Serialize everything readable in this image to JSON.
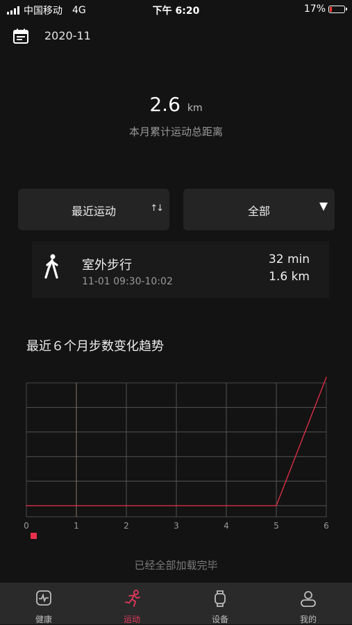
{
  "status_bar": {
    "carrier": "中国移动",
    "network": "4G",
    "time": "下午 6:20",
    "battery": "17%",
    "battery_level": 0.17
  },
  "header": {
    "month": "2020-11",
    "calendar_icon": "calendar-icon"
  },
  "summary": {
    "value": "2.6",
    "unit": "km",
    "label": "本月累计运动总距离"
  },
  "filters": {
    "sort_label": "最近运动",
    "sort_icon": "sort-arrows-icon",
    "type_label": "全部",
    "type_icon": "dropdown-triangle-icon"
  },
  "record": {
    "icon": "walking-icon",
    "title": "室外步行",
    "time": "11-01 09:30-10:02",
    "duration": "32 min",
    "distance": "1.6 km"
  },
  "chart_title": "最近６个月步数变化趋势",
  "chart_data": {
    "type": "line",
    "x": [
      0,
      1,
      2,
      3,
      4,
      5,
      6
    ],
    "series": [
      {
        "values": [
          0,
          0,
          0,
          0,
          0,
          0,
          5
        ],
        "color": "#e8304a"
      }
    ],
    "xlim": [
      0,
      6
    ],
    "ylim": [
      0,
      5
    ],
    "grid": true,
    "legend": "bottom-left"
  },
  "footer_text": "已经全部加载完毕",
  "tabs": [
    {
      "label": "健康",
      "icon": "heart-rate-icon",
      "active": false
    },
    {
      "label": "运动",
      "icon": "running-icon",
      "active": true
    },
    {
      "label": "设备",
      "icon": "watch-icon",
      "active": false
    },
    {
      "label": "我的",
      "icon": "profile-icon",
      "active": false
    }
  ],
  "colors": {
    "background": "#131313",
    "accent": "#e83a5e",
    "card": "#242424"
  }
}
